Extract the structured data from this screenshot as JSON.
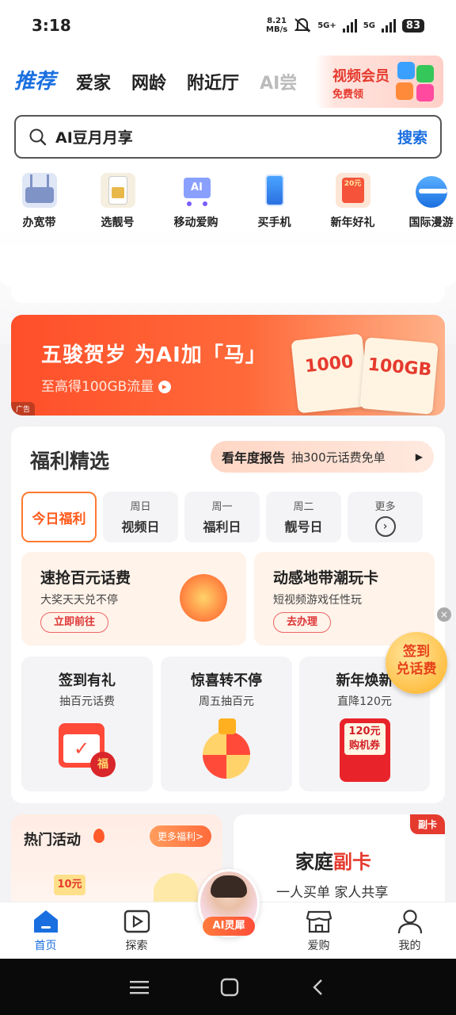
{
  "status": {
    "time": "3:18",
    "speed_top": "8.21",
    "speed_bottom": "MB/s",
    "net1": "5G+",
    "net2": "5G",
    "battery": "83"
  },
  "tabs": [
    {
      "label": "推荐"
    },
    {
      "label": "爱家"
    },
    {
      "label": "网龄"
    },
    {
      "label": "附近厅"
    },
    {
      "label": "AI尝"
    }
  ],
  "vip": {
    "title": "视频会员",
    "sub": "免费领"
  },
  "search": {
    "query": "AI豆月月享",
    "button": "搜索"
  },
  "icons": [
    {
      "label": "办宽带",
      "name": "router-icon"
    },
    {
      "label": "选靓号",
      "name": "sim-card-icon"
    },
    {
      "label": "移动爱购",
      "name": "shopping-cart-icon"
    },
    {
      "label": "买手机",
      "name": "phone-icon"
    },
    {
      "label": "新年好礼",
      "name": "gift-card-icon"
    },
    {
      "label": "国际漫游",
      "name": "airplane-icon"
    }
  ],
  "banner": {
    "headline": "五骏贺岁 为AI加「马」",
    "sub": "至高得100GB流量",
    "ad": "广告",
    "card1": "1000",
    "card2": "100GB"
  },
  "welfare": {
    "title": "福利精选",
    "report_main": "看年度报告",
    "report_sub": "抽300元话费免单",
    "days": [
      {
        "top": "",
        "label": "今日福利"
      },
      {
        "top": "周日",
        "label": "视频日"
      },
      {
        "top": "周一",
        "label": "福利日"
      },
      {
        "top": "周二",
        "label": "靓号日"
      },
      {
        "top": "更多",
        "label": ""
      }
    ],
    "promos": [
      {
        "title": "速抢百元话费",
        "sub": "大奖天天兑不停",
        "btn": "立即前往"
      },
      {
        "title": "动感地带潮玩卡",
        "sub": "短视频游戏任性玩",
        "btn": "去办理"
      }
    ],
    "minis": [
      {
        "title": "签到有礼",
        "sub": "抽百元话费"
      },
      {
        "title": "惊喜转不停",
        "sub": "周五抽百元"
      },
      {
        "title": "新年焕新",
        "sub": "直降120元",
        "coupon": "120元 购机券"
      }
    ]
  },
  "float": {
    "line1": "签到",
    "line2": "兑话费"
  },
  "hot": {
    "title": "热门活动",
    "more": "更多福利>",
    "coupon": "10元"
  },
  "family": {
    "tag": "副卡",
    "title_a": "家庭",
    "title_b": "副卡",
    "sub": "一人买单 家人共享"
  },
  "nav": [
    {
      "label": "首页"
    },
    {
      "label": "探索"
    },
    {
      "label": "AI灵犀"
    },
    {
      "label": "爱购"
    },
    {
      "label": "我的"
    }
  ],
  "colors": {
    "accent": "#1a6fe0",
    "brand_red": "#e53a2e",
    "orange": "#ff6a3a"
  }
}
